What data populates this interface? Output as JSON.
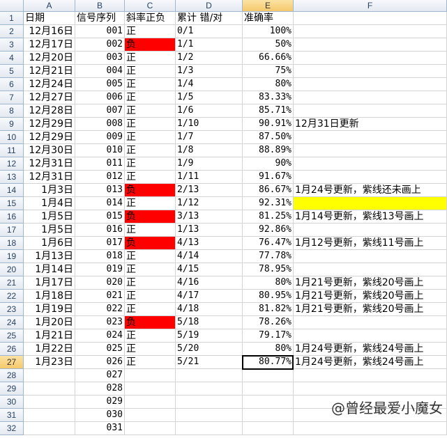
{
  "columns": [
    "A",
    "B",
    "C",
    "D",
    "E",
    "F"
  ],
  "header_row": [
    "日期",
    "信号序列",
    "斜率正负",
    "累计 错/对",
    "准确率",
    ""
  ],
  "rows": [
    {
      "date": "12月16日",
      "seq": "001",
      "slope": "正",
      "cum": "0/1",
      "acc": "100%",
      "note": ""
    },
    {
      "date": "12月17日",
      "seq": "002",
      "slope": "负",
      "cum": "1/1",
      "acc": "50%",
      "note": ""
    },
    {
      "date": "12月20日",
      "seq": "003",
      "slope": "正",
      "cum": "1/2",
      "acc": "66.66%",
      "note": ""
    },
    {
      "date": "12月21日",
      "seq": "004",
      "slope": "正",
      "cum": "1/3",
      "acc": "75%",
      "note": ""
    },
    {
      "date": "12月24日",
      "seq": "005",
      "slope": "正",
      "cum": "1/4",
      "acc": "80%",
      "note": ""
    },
    {
      "date": "12月27日",
      "seq": "006",
      "slope": "正",
      "cum": "1/5",
      "acc": "83.33%",
      "note": ""
    },
    {
      "date": "12月28日",
      "seq": "007",
      "slope": "正",
      "cum": "1/6",
      "acc": "85.71%",
      "note": ""
    },
    {
      "date": "12月29日",
      "seq": "008",
      "slope": "正",
      "cum": "1/10",
      "acc": "90.91%",
      "note": "12月31日更新"
    },
    {
      "date": "12月29日",
      "seq": "009",
      "slope": "正",
      "cum": "1/7",
      "acc": "87.50%",
      "note": ""
    },
    {
      "date": "12月30日",
      "seq": "010",
      "slope": "正",
      "cum": "1/8",
      "acc": "88.89%",
      "note": ""
    },
    {
      "date": "12月31日",
      "seq": "011",
      "slope": "正",
      "cum": "1/9",
      "acc": "90%",
      "note": ""
    },
    {
      "date": "12月31日",
      "seq": "012",
      "slope": "正",
      "cum": "1/11",
      "acc": "91.67%",
      "note": ""
    },
    {
      "date": "1月3日",
      "seq": "013",
      "slope": "负",
      "cum": "2/13",
      "acc": "86.67%",
      "note": "1月24号更新，紫线还未画上"
    },
    {
      "date": "1月4日",
      "seq": "014",
      "slope": "正",
      "cum": "1/12",
      "acc": "92.31%",
      "note": ""
    },
    {
      "date": "1月5日",
      "seq": "015",
      "slope": "负",
      "cum": "3/13",
      "acc": "81.25%",
      "note": "1月14号更新，紫线13号画上"
    },
    {
      "date": "1月5日",
      "seq": "016",
      "slope": "正",
      "cum": "1/13",
      "acc": "92.86%",
      "note": ""
    },
    {
      "date": "1月6日",
      "seq": "017",
      "slope": "负",
      "cum": "4/13",
      "acc": "76.47%",
      "note": "1月12号更新，紫线11号画上"
    },
    {
      "date": "1月13日",
      "seq": "018",
      "slope": "正",
      "cum": "4/14",
      "acc": "77.78%",
      "note": ""
    },
    {
      "date": "1月14日",
      "seq": "019",
      "slope": "正",
      "cum": "4/15",
      "acc": "78.95%",
      "note": ""
    },
    {
      "date": "1月17日",
      "seq": "020",
      "slope": "正",
      "cum": "4/16",
      "acc": "80%",
      "note": "1月21号更新，紫线20号画上"
    },
    {
      "date": "1月18日",
      "seq": "021",
      "slope": "正",
      "cum": "4/17",
      "acc": "80.95%",
      "note": "1月21号更新，紫线20号画上"
    },
    {
      "date": "1月19日",
      "seq": "022",
      "slope": "正",
      "cum": "4/18",
      "acc": "81.82%",
      "note": "1月21号更新，紫线20号画上"
    },
    {
      "date": "1月20日",
      "seq": "023",
      "slope": "负",
      "cum": "5/18",
      "acc": "78.26%",
      "note": ""
    },
    {
      "date": "1月21日",
      "seq": "024",
      "slope": "正",
      "cum": "5/19",
      "acc": "79.17%",
      "note": ""
    },
    {
      "date": "1月22日",
      "seq": "025",
      "slope": "正",
      "cum": "5/20",
      "acc": "80%",
      "note": "1月24号更新，紫线24号画上"
    },
    {
      "date": "1月23日",
      "seq": "026",
      "slope": "正",
      "cum": "5/21",
      "acc": "80.77%",
      "note": "1月24号更新，紫线24号画上"
    },
    {
      "date": "",
      "seq": "027",
      "slope": "",
      "cum": "",
      "acc": "",
      "note": ""
    },
    {
      "date": "",
      "seq": "028",
      "slope": "",
      "cum": "",
      "acc": "",
      "note": ""
    },
    {
      "date": "",
      "seq": "029",
      "slope": "",
      "cum": "",
      "acc": "",
      "note": ""
    },
    {
      "date": "",
      "seq": "030",
      "slope": "",
      "cum": "",
      "acc": "",
      "note": ""
    },
    {
      "date": "",
      "seq": "031",
      "slope": "",
      "cum": "",
      "acc": "",
      "note": ""
    }
  ],
  "highlight_colors": {
    "negative": "#ff0000",
    "note_highlight": "#ffff00"
  },
  "highlighted_note_row": 13,
  "active_cell": {
    "column": "E",
    "row": 27
  },
  "watermark": "@曾经最爱小魔女"
}
